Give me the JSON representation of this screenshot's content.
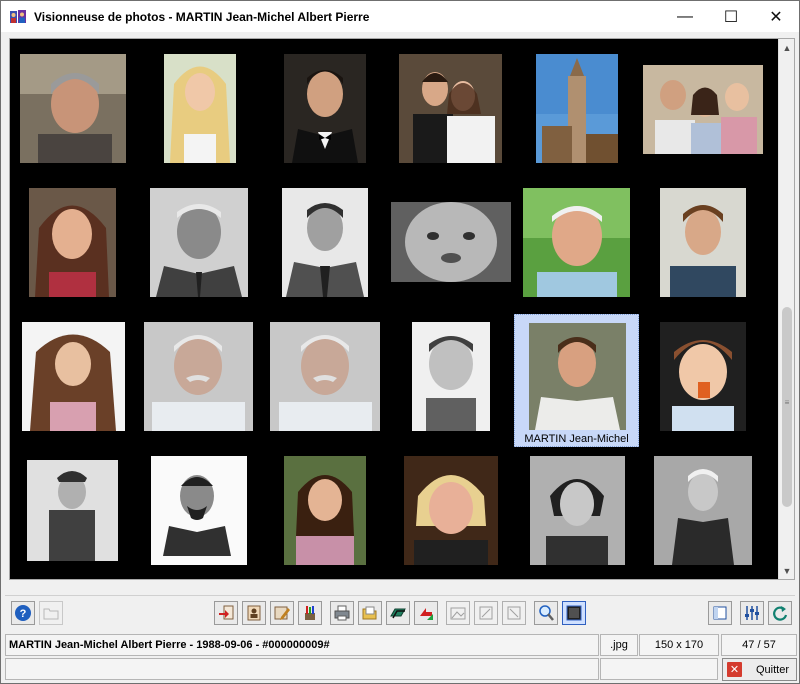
{
  "window": {
    "title": "Visionneuse de photos - MARTIN Jean-Michel Albert Pierre",
    "minimize_glyph": "—",
    "maximize_glyph": "☐",
    "close_glyph": "✕"
  },
  "gallery": {
    "selected_caption": "MARTIN Jean-Michel",
    "photos": [
      {
        "name": "photo-middle-aged-man-gray-hair"
      },
      {
        "name": "photo-blonde-woman"
      },
      {
        "name": "photo-man-in-tuxedo"
      },
      {
        "name": "photo-wedding-couple"
      },
      {
        "name": "photo-cathedral-tower"
      },
      {
        "name": "photo-family-portrait"
      },
      {
        "name": "photo-smiling-girl"
      },
      {
        "name": "photo-elderly-man-bw"
      },
      {
        "name": "photo-man-in-suit-bw"
      },
      {
        "name": "photo-baby-bw"
      },
      {
        "name": "photo-smiling-elderly-man"
      },
      {
        "name": "photo-teen-boy"
      },
      {
        "name": "photo-little-girl-curly-hair"
      },
      {
        "name": "photo-old-man-mustache"
      },
      {
        "name": "photo-old-man-mustache-copy"
      },
      {
        "name": "photo-toddler-bw"
      },
      {
        "name": "photo-selected-man-sweater"
      },
      {
        "name": "photo-toddler-eating"
      },
      {
        "name": "photo-boy-vintage-engraving"
      },
      {
        "name": "photo-man-vintage-engraving"
      },
      {
        "name": "photo-young-woman-smiling"
      },
      {
        "name": "photo-older-woman-blonde"
      },
      {
        "name": "photo-woman-vintage-portrait"
      },
      {
        "name": "photo-elderly-woman-bw"
      }
    ]
  },
  "scrollbar": {
    "up_glyph": "▲",
    "down_glyph": "▼",
    "grip_glyph": "≡"
  },
  "status": {
    "person_line": "MARTIN Jean-Michel Albert Pierre - 1988-09-06 - #000000009#",
    "extension": ".jpg",
    "dimensions": "150 x 170",
    "counter": "47 / 57"
  },
  "quit": {
    "label": "Quitter",
    "icon_glyph": "✕"
  },
  "colors": {
    "gallery_background": "#000000",
    "selection_background": "#c8d8f8",
    "quit_icon": "#d43b2e",
    "help_icon": "#1f5fbf"
  }
}
